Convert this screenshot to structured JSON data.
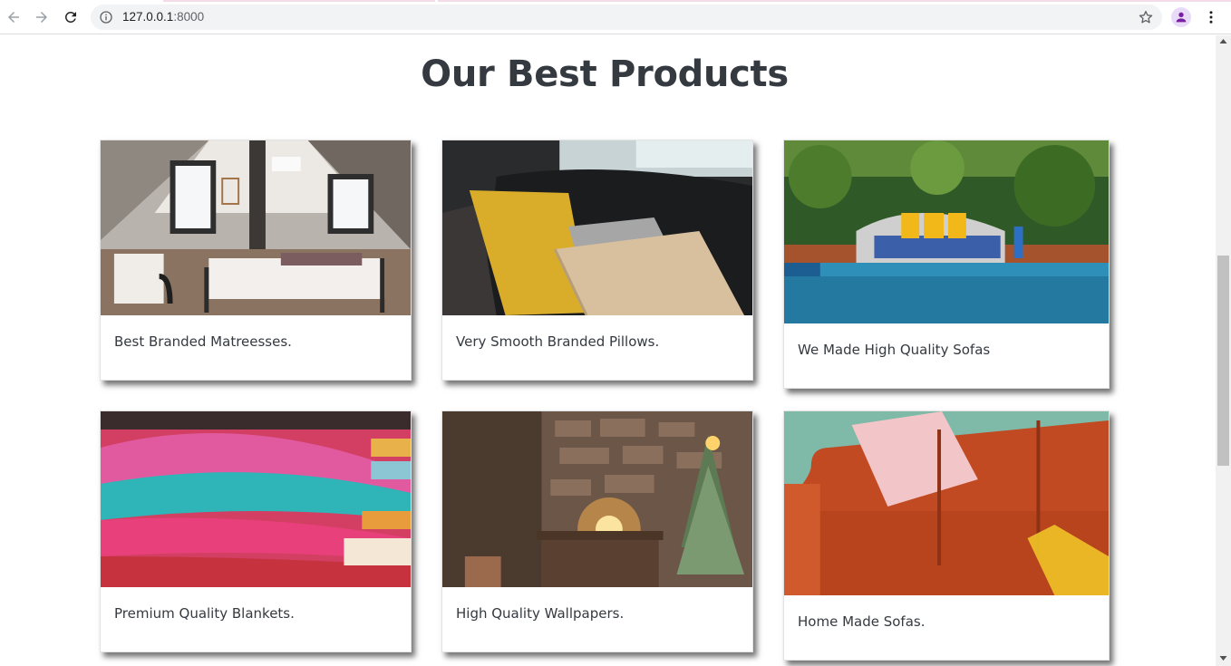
{
  "browser": {
    "url_host": "127.0.0.1",
    "url_port": ":8000",
    "icons": [
      "back-arrow-icon",
      "forward-arrow-icon",
      "reload-icon",
      "info-icon",
      "star-icon",
      "profile-icon",
      "more-vert-icon"
    ]
  },
  "page": {
    "title": "Our Best Products"
  },
  "products": [
    {
      "caption": "Best Branded Matreesses.",
      "image": "bedroom-photo"
    },
    {
      "caption": "Very Smooth Branded Pillows.",
      "image": "pillows-photo"
    },
    {
      "caption": "We Made High Quality Sofas",
      "image": "poolside-sofa-photo"
    },
    {
      "caption": "Premium Quality Blankets.",
      "image": "blankets-photo"
    },
    {
      "caption": "High Quality Wallpapers.",
      "image": "stone-wall-fireplace-photo"
    },
    {
      "caption": "Home Made Sofas.",
      "image": "orange-sofa-photo"
    }
  ]
}
